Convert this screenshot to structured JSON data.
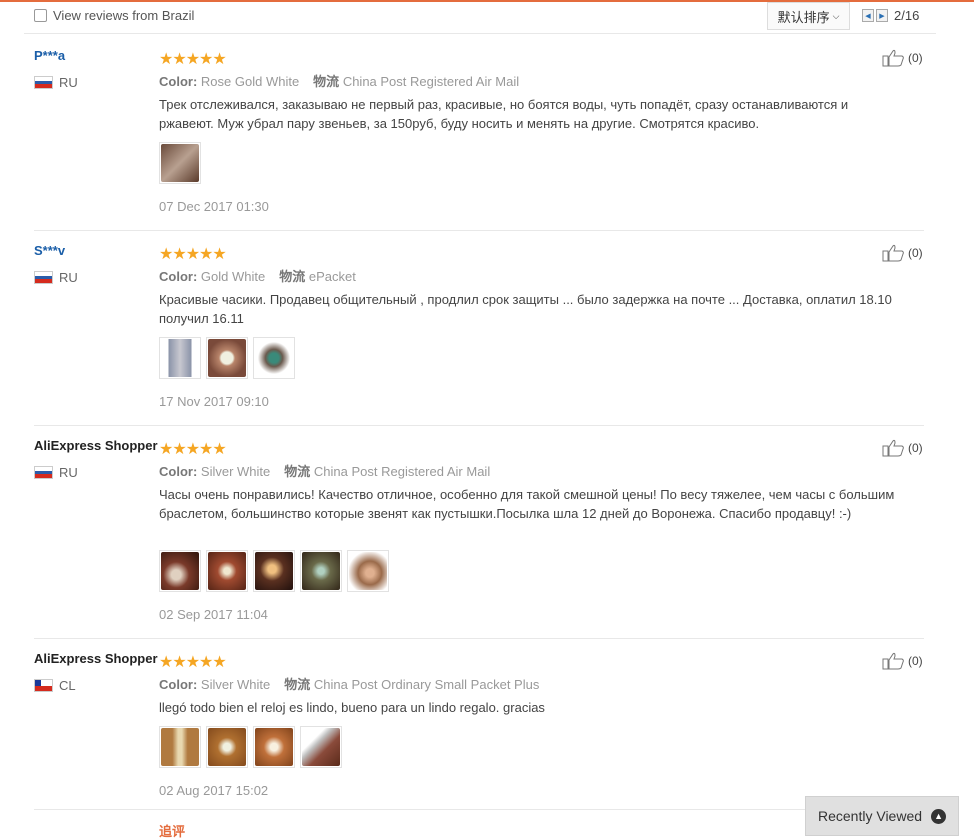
{
  "toolbar": {
    "filter_label": "View reviews from Brazil",
    "sort_label": "默认排序",
    "page_indicator": "2/16"
  },
  "reviews": [
    {
      "user": "P***a",
      "country": "RU",
      "rating": "★★★★★",
      "color_label": "Color:",
      "color_value": "Rose Gold White",
      "shipping_label": "物流",
      "shipping_value": "China Post Registered Air Mail",
      "text": "Трек отслеживался, заказываю не первый раз, красивые, но боятся воды, чуть попадёт, сразу останавливаются и ржавеют. Муж убрал пару звеньев, за 150руб, буду носить и менять на другие. Смотрятся красиво.",
      "date": "07 Dec 2017 01:30",
      "helpful": "(0)",
      "photo_colors": [
        "#8a6a5a"
      ]
    },
    {
      "user": "S***v",
      "country": "RU",
      "rating": "★★★★★",
      "color_label": "Color:",
      "color_value": "Gold White",
      "shipping_label": "物流",
      "shipping_value": "ePacket",
      "text": "Красивые часики. Продавец общительный , продлил срок защиты ... было задержка на почте ... Доставка, оплатил 18.10 получил 16.11",
      "date": "17 Nov 2017 09:10",
      "helpful": "(0)",
      "photo_colors": [
        "#8a93a8",
        "#b8846a",
        "#6b5a4e"
      ]
    },
    {
      "user": "AliExpress Shopper",
      "country": "RU",
      "rating": "★★★★★",
      "color_label": "Color:",
      "color_value": "Silver White",
      "shipping_label": "物流",
      "shipping_value": "China Post Registered Air Mail",
      "text": "Часы очень понравились! Качество отличное, особенно для такой смешной цены! По весу тяжелее, чем часы с большим браслетом, большинство которые звенят как пустышки.Посылка шла 12 дней до Воронежа. Спасибо продавцу! :-)",
      "date": "02 Sep 2017 11:04",
      "helpful": "(0)",
      "photo_colors": [
        "#7a3a2a",
        "#a04a30",
        "#5a3020",
        "#6a6a4a",
        "#9a6a4a"
      ]
    },
    {
      "user": "AliExpress Shopper",
      "country": "CL",
      "rating": "★★★★★",
      "color_label": "Color:",
      "color_value": "Silver White",
      "shipping_label": "物流",
      "shipping_value": "China Post Ordinary Small Packet Plus",
      "text": "llegó todo bien el reloj es lindo, bueno para un lindo regalo. gracias",
      "date": "02 Aug 2017 15:02",
      "helpful": "(0)",
      "photo_colors": [
        "#a06a30",
        "#b07030",
        "#c0703a",
        "#8a4a3a"
      ]
    }
  ],
  "followup_label": "追评",
  "recently_viewed": "Recently Viewed"
}
